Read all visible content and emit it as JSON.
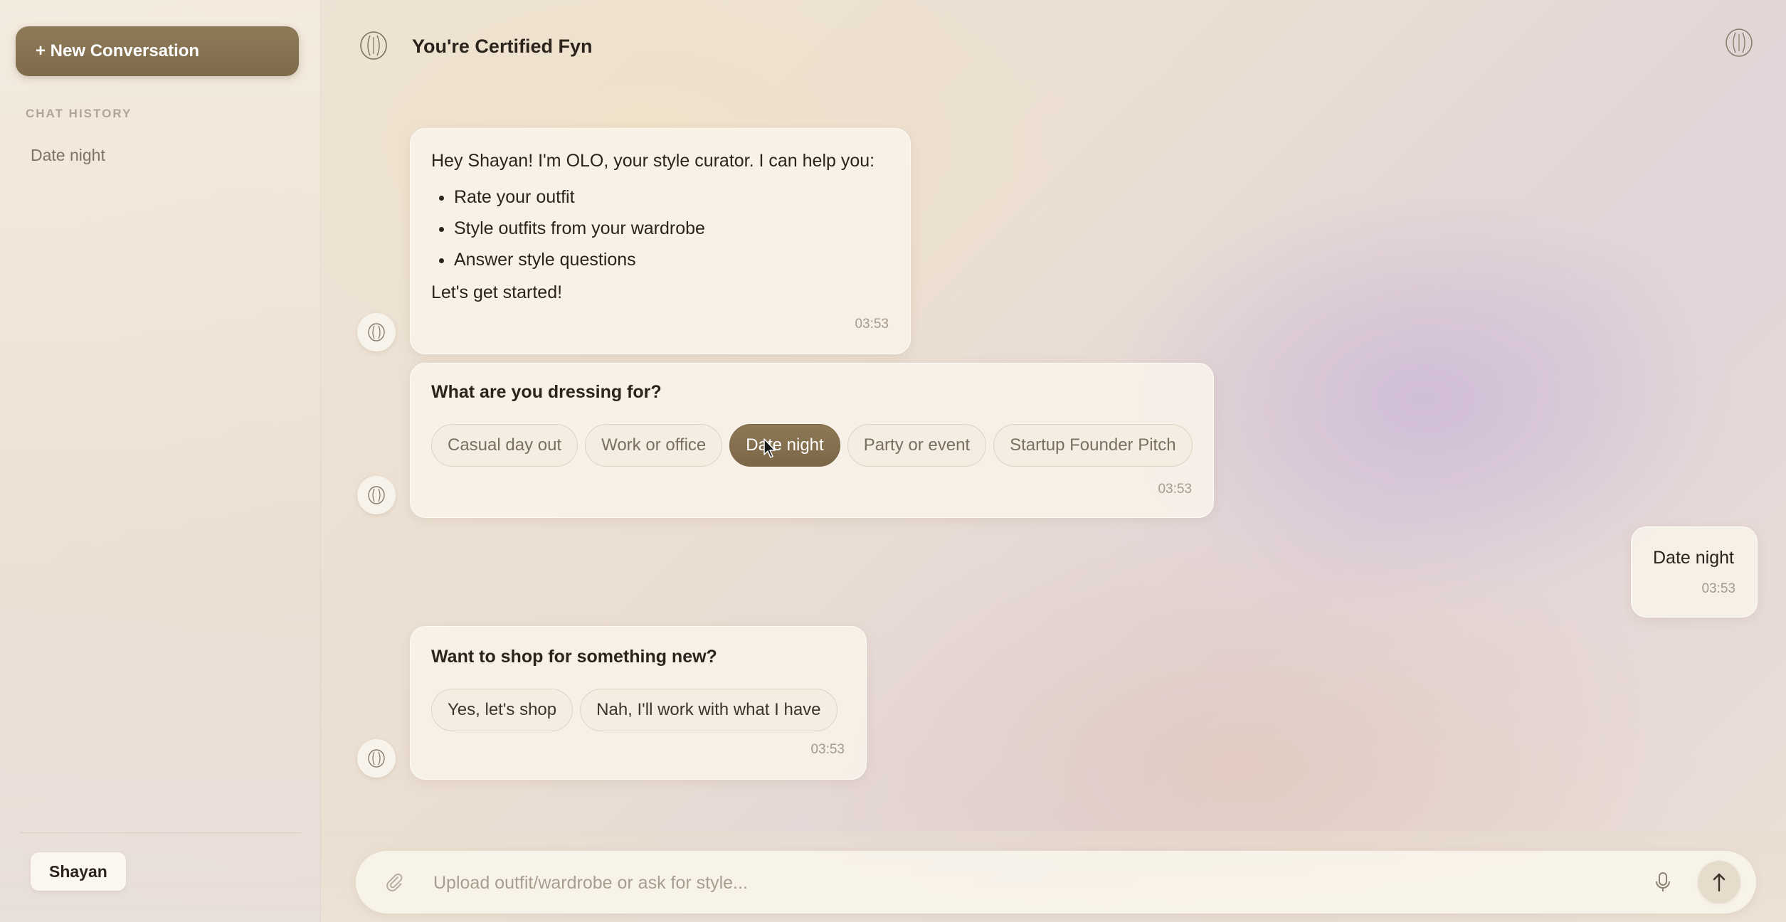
{
  "sidebar": {
    "new_conversation_label": "+ New Conversation",
    "history_title": "CHAT HISTORY",
    "history_items": [
      "Date night"
    ],
    "user_name": "Shayan"
  },
  "header": {
    "title": "You're Certified Fyn",
    "logo_icon": "olo-logo-icon"
  },
  "messages": [
    {
      "sender": "assistant",
      "intro": "Hey Shayan! I'm OLO, your style curator. I can help you:",
      "bullets": [
        "Rate your outfit",
        "Style outfits from your wardrobe",
        "Answer style questions"
      ],
      "closing": "Let's get started!",
      "time": "03:53"
    },
    {
      "sender": "assistant",
      "question": "What are you dressing for?",
      "options": [
        "Casual day out",
        "Work or office",
        "Date night",
        "Party or event",
        "Startup Founder Pitch"
      ],
      "selected": "Date night",
      "time": "03:53"
    },
    {
      "sender": "user",
      "text": "Date night",
      "time": "03:53"
    },
    {
      "sender": "assistant",
      "question": "Want to shop for something new?",
      "options": [
        "Yes, let's shop",
        "Nah, I'll work with what I have"
      ],
      "time": "03:53"
    }
  ],
  "composer": {
    "placeholder": "Upload outfit/wardrobe or ask for style...",
    "value": ""
  },
  "colors": {
    "accent": "#857050",
    "text": "#2a241c",
    "muted": "#a69a8a"
  }
}
